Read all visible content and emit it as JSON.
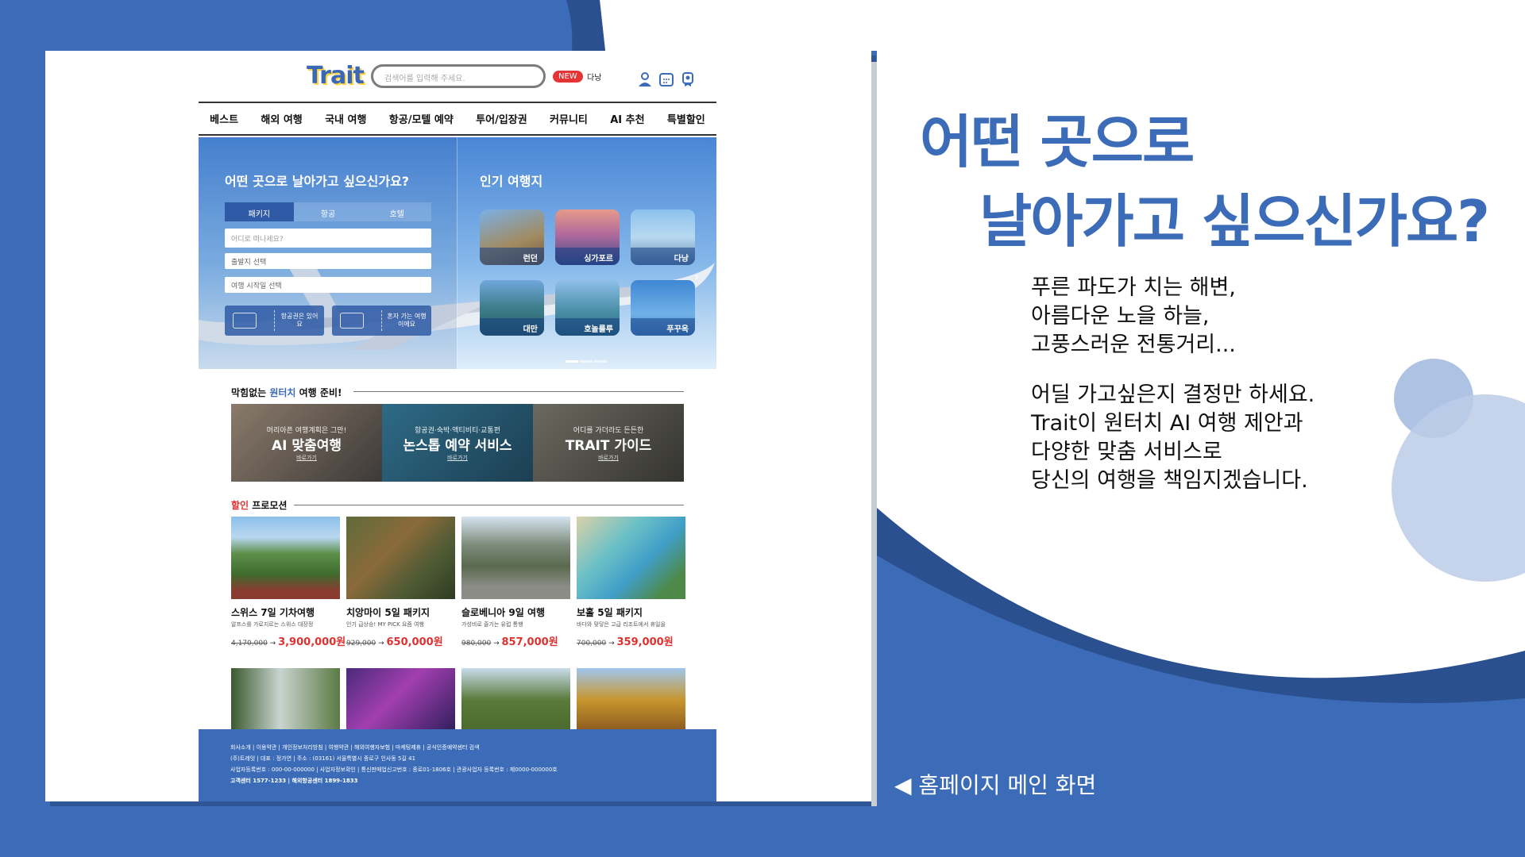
{
  "site": {
    "logo": "Trait",
    "search_placeholder": "검색어를 입력해 주세요.",
    "new_badge": "NEW",
    "new_text": "다낭",
    "nav": [
      "베스트",
      "해외 여행",
      "국내 여행",
      "항공/모텔 예약",
      "투어/입장권",
      "커뮤니티",
      "AI 추천",
      "특별할인"
    ],
    "hero": {
      "search_title": "어떤 곳으로 날아가고 싶으신가요?",
      "tabs": [
        "패키지",
        "항공",
        "호텔"
      ],
      "fields": [
        "어디로 떠나세요?",
        "출발지 선택",
        "여행 시작일 선택"
      ],
      "buttons": [
        "항공권은 있어요",
        "혼자 가는 여행이에요"
      ],
      "popular_title": "인기 여행지",
      "destinations": [
        "런던",
        "싱가포르",
        "다낭",
        "대만",
        "호놀룰루",
        "푸꾸옥"
      ]
    },
    "service_section": {
      "title_pre": "막힘없는 ",
      "title_hl": "원터치",
      "title_post": " 여행 준비!",
      "panels": [
        {
          "sub": "머리아픈 여행계획은 그만!",
          "title": "AI 맞춤여행",
          "link": "바로가기"
        },
        {
          "sub": "항공권·숙박·액티비티·교통편",
          "title": "논스톱 예약 서비스",
          "link": "바로가기"
        },
        {
          "sub": "어디를 가더라도 든든한",
          "title": "TRAIT 가이드",
          "link": "바로가기"
        }
      ]
    },
    "promo_section": {
      "title_hl": "할인",
      "title_post": " 프로모션",
      "items": [
        {
          "name": "스위스 7일 기차여행",
          "desc": "알프스를 가로지르는 스위스 대장정",
          "old": "4,170,000",
          "new": "3,900,000원"
        },
        {
          "name": "치앙마이 5일 패키지",
          "desc": "인기 급상승! MY PICK 요즘 여행",
          "old": "929,000",
          "new": "650,000원"
        },
        {
          "name": "슬로베니아 9일 여행",
          "desc": "가성비로 즐기는 유럽 통행",
          "old": "980,000",
          "new": "857,000원"
        },
        {
          "name": "보홀 5일 패키지",
          "desc": "바다와 맞닿은 고급 리조트에서 휴일을",
          "old": "700,000",
          "new": "359,000원"
        }
      ]
    },
    "footer": {
      "links": "회사소개   |   이용약관   |   개인정보처리방침   |   여행약관   |   해외여행자보험   |   마케팅제휴   |   공식인증예약센터 검색",
      "line1": "(주)트레잇   |   대표 : 정가연   |   주소 : (03161) 서울특별시 종로구 인사동 5길 41",
      "line2": "사업자등록번호 : 000-00-000000   |   사업자정보확인   |   통신판매업신고번호 : 종로01-1806호   |   관광사업자 등록번호 : 제0000-000000호",
      "line3": "고객센터 1577-1233   |   해외항공센터 1899-1833"
    }
  },
  "slide": {
    "heading_line1": "어떤 곳으로",
    "heading_line2": "날아가고 싶으신가요?",
    "para1": "푸른 파도가 치는 해변,\n아름다운 노을 하늘,\n고풍스러운 전통거리...",
    "para2": "어딜 가고싶은지 결정만 하세요.\nTrait이 원터치 AI 여행 제안과\n다양한 맞춤 서비스로\n당신의 여행을 책임지겠습니다.",
    "caption": "◀ 홈페이지 메인 화면"
  },
  "colors": {
    "brand_blue": "#3c6cb8",
    "sale_red": "#e03131",
    "dark_blue": "#2a5090"
  }
}
